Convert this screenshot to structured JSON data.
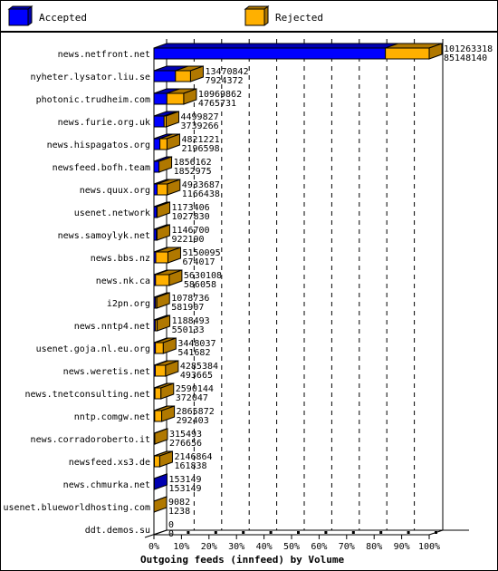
{
  "chart_data": {
    "type": "bar",
    "orientation": "horizontal",
    "stacked": true,
    "style": "3d",
    "title": "Outgoing feeds (innfeed) by Volume",
    "xlabel": "Outgoing feeds (innfeed) by Volume",
    "ylabel": "",
    "xlim": [
      0,
      100
    ],
    "x_unit": "%",
    "x_ticks": [
      "0%",
      "10%",
      "20%",
      "30%",
      "40%",
      "50%",
      "60%",
      "70%",
      "80%",
      "90%",
      "100%"
    ],
    "grid": "vertical-dashed",
    "legend_position": "top",
    "legend": [
      {
        "name": "Accepted",
        "color": "#0000FF"
      },
      {
        "name": "Rejected",
        "color": "#FFB000"
      }
    ],
    "categories": [
      "news.netfront.net",
      "nyheter.lysator.liu.se",
      "photonic.trudheim.com",
      "news.furie.org.uk",
      "news.hispagatos.org",
      "newsfeed.bofh.team",
      "news.quux.org",
      "usenet.network",
      "news.samoylyk.net",
      "news.bbs.nz",
      "news.nk.ca",
      "i2pn.org",
      "news.nntp4.net",
      "usenet.goja.nl.eu.org",
      "news.weretis.net",
      "news.tnetconsulting.net",
      "nntp.comgw.net",
      "news.corradoroberto.it",
      "newsfeed.xs3.de",
      "news.chmurka.net",
      "usenet.blueworldhosting.com",
      "ddt.demos.su"
    ],
    "offered": [
      101263318,
      13470842,
      10969862,
      4499827,
      4821221,
      1856162,
      4933687,
      1173406,
      1146700,
      5150095,
      5630108,
      1078736,
      1188493,
      3448037,
      4285384,
      2590144,
      2865872,
      315493,
      2146864,
      153149,
      9082,
      0
    ],
    "accepted": [
      85148140,
      7924372,
      4765731,
      3739266,
      2196598,
      1852975,
      1166438,
      1027830,
      922190,
      674017,
      586058,
      581907,
      550133,
      541682,
      493665,
      372047,
      292403,
      276656,
      161838,
      153149,
      1238,
      0
    ]
  }
}
